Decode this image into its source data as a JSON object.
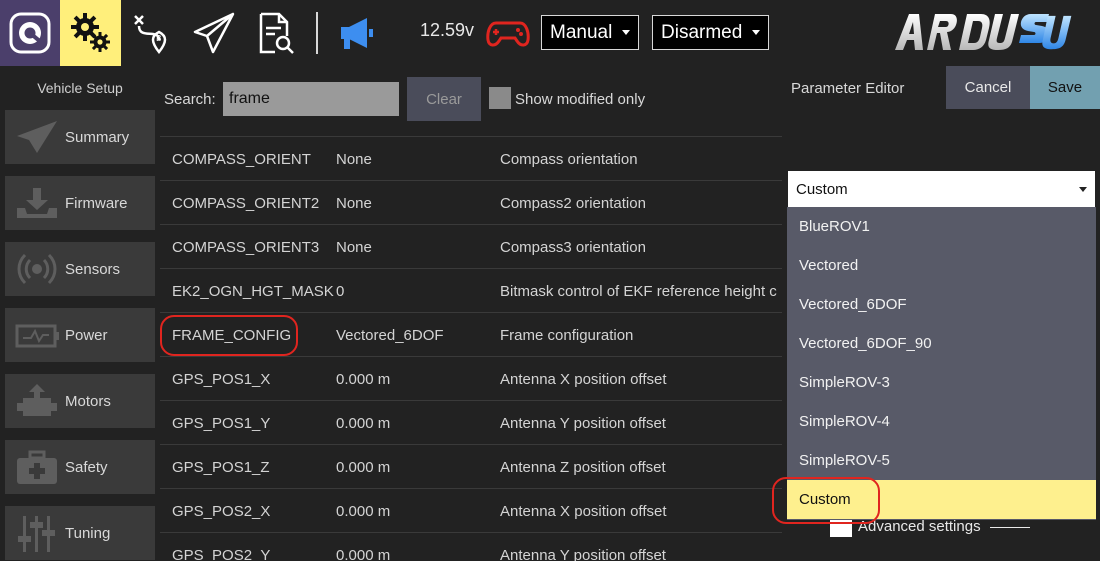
{
  "toolbar": {
    "voltage": "12.59v",
    "flight_mode": "Manual",
    "arm_state": "Disarmed",
    "icons": [
      "qgc-logo-icon",
      "gears-icon",
      "plan-route-icon",
      "fly-paper-plane-icon",
      "analyze-document-icon",
      "megaphone-icon",
      "gamepad-icon"
    ],
    "colors": {
      "setup_active": "#ffef7b",
      "qgc_bg": "#4b3f6b",
      "message_icon": "#3d8ef0",
      "gamepad": "#e0251f"
    }
  },
  "setup": {
    "title": "Vehicle Setup",
    "items": [
      {
        "label": "Summary",
        "icon": "paper-plane-icon"
      },
      {
        "label": "Firmware",
        "icon": "download-icon"
      },
      {
        "label": "Sensors",
        "icon": "radio-signal-icon"
      },
      {
        "label": "Power",
        "icon": "battery-icon"
      },
      {
        "label": "Motors",
        "icon": "motor-icon"
      },
      {
        "label": "Safety",
        "icon": "first-aid-icon"
      },
      {
        "label": "Tuning",
        "icon": "sliders-icon"
      }
    ]
  },
  "params": {
    "search_label": "Search:",
    "search_value": "frame",
    "clear_label": "Clear",
    "show_modified_label": "Show modified only",
    "rows": [
      {
        "name": "COMPASS_ORIENT",
        "value": "None",
        "desc": "Compass orientation"
      },
      {
        "name": "COMPASS_ORIENT2",
        "value": "None",
        "desc": "Compass2 orientation"
      },
      {
        "name": "COMPASS_ORIENT3",
        "value": "None",
        "desc": "Compass3 orientation"
      },
      {
        "name": "EK2_OGN_HGT_MASK",
        "value": "0",
        "desc": "Bitmask control of EKF reference height c"
      },
      {
        "name": "FRAME_CONFIG",
        "value": "Vectored_6DOF",
        "desc": "Frame configuration"
      },
      {
        "name": "GPS_POS1_X",
        "value": "0.000 m",
        "desc": "Antenna X position offset"
      },
      {
        "name": "GPS_POS1_Y",
        "value": "0.000 m",
        "desc": "Antenna Y position offset"
      },
      {
        "name": "GPS_POS1_Z",
        "value": "0.000 m",
        "desc": "Antenna Z position offset"
      },
      {
        "name": "GPS_POS2_X",
        "value": "0.000 m",
        "desc": "Antenna X position offset"
      },
      {
        "name": "GPS_POS2_Y",
        "value": "0.000 m",
        "desc": "Antenna Y position offset"
      }
    ]
  },
  "editor": {
    "title": "Parameter Editor",
    "cancel_label": "Cancel",
    "save_label": "Save",
    "combo_value": "Custom",
    "options": [
      "BlueROV1",
      "Vectored",
      "Vectored_6DOF",
      "Vectored_6DOF_90",
      "SimpleROV-3",
      "SimpleROV-4",
      "SimpleROV-5",
      "Custom"
    ],
    "selected_option": "Custom",
    "advanced_label": "Advanced settings"
  }
}
